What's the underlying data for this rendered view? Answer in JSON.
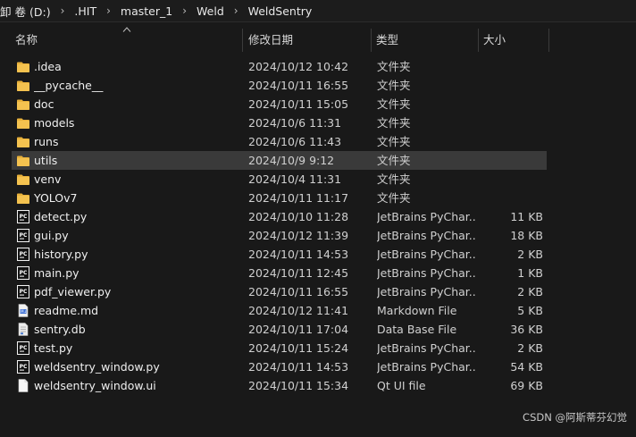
{
  "breadcrumb": [
    "卷 (D:)",
    ".HIT",
    "master_1",
    "Weld",
    "WeldSentry"
  ],
  "breadcrumb_prefix": "卸",
  "columns": {
    "name": "名称",
    "date": "修改日期",
    "type": "类型",
    "size": "大小"
  },
  "files": [
    {
      "name": ".idea",
      "date": "2024/10/12 10:42",
      "type": "文件夹",
      "size": "",
      "icon": "folder-icon"
    },
    {
      "name": "__pycache__",
      "date": "2024/10/11 16:55",
      "type": "文件夹",
      "size": "",
      "icon": "folder-icon"
    },
    {
      "name": "doc",
      "date": "2024/10/11 15:05",
      "type": "文件夹",
      "size": "",
      "icon": "folder-icon"
    },
    {
      "name": "models",
      "date": "2024/10/6 11:31",
      "type": "文件夹",
      "size": "",
      "icon": "folder-icon"
    },
    {
      "name": "runs",
      "date": "2024/10/6 11:43",
      "type": "文件夹",
      "size": "",
      "icon": "folder-icon"
    },
    {
      "name": "utils",
      "date": "2024/10/9 9:12",
      "type": "文件夹",
      "size": "",
      "icon": "folder-icon",
      "selected": true
    },
    {
      "name": "venv",
      "date": "2024/10/4 11:31",
      "type": "文件夹",
      "size": "",
      "icon": "folder-icon"
    },
    {
      "name": "YOLOv7",
      "date": "2024/10/11 11:17",
      "type": "文件夹",
      "size": "",
      "icon": "folder-icon"
    },
    {
      "name": "detect.py",
      "date": "2024/10/10 11:28",
      "type": "JetBrains PyChar...",
      "size": "11 KB",
      "icon": "pycharm-file-icon"
    },
    {
      "name": "gui.py",
      "date": "2024/10/12 11:39",
      "type": "JetBrains PyChar...",
      "size": "18 KB",
      "icon": "pycharm-file-icon"
    },
    {
      "name": "history.py",
      "date": "2024/10/11 14:53",
      "type": "JetBrains PyChar...",
      "size": "2 KB",
      "icon": "pycharm-file-icon"
    },
    {
      "name": "main.py",
      "date": "2024/10/11 12:45",
      "type": "JetBrains PyChar...",
      "size": "1 KB",
      "icon": "pycharm-file-icon"
    },
    {
      "name": "pdf_viewer.py",
      "date": "2024/10/11 16:55",
      "type": "JetBrains PyChar...",
      "size": "2 KB",
      "icon": "pycharm-file-icon"
    },
    {
      "name": "readme.md",
      "date": "2024/10/12 11:41",
      "type": "Markdown File",
      "size": "5 KB",
      "icon": "markdown-file-icon"
    },
    {
      "name": "sentry.db",
      "date": "2024/10/11 17:04",
      "type": "Data Base File",
      "size": "36 KB",
      "icon": "database-file-icon"
    },
    {
      "name": "test.py",
      "date": "2024/10/11 15:24",
      "type": "JetBrains PyChar...",
      "size": "2 KB",
      "icon": "pycharm-file-icon"
    },
    {
      "name": "weldsentry_window.py",
      "date": "2024/10/11 14:53",
      "type": "JetBrains PyChar...",
      "size": "54 KB",
      "icon": "pycharm-file-icon"
    },
    {
      "name": "weldsentry_window.ui",
      "date": "2024/10/11 15:34",
      "type": "Qt UI file",
      "size": "69 KB",
      "icon": "blank-file-icon"
    }
  ],
  "watermark": "CSDN @阿斯蒂芬幻觉",
  "colors": {
    "background": "#191919",
    "selected_row": "#3a3a3a",
    "folder": "#e8b13b",
    "pycharm_icon": "#f2f2f2"
  }
}
